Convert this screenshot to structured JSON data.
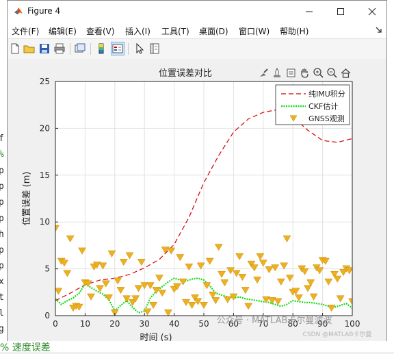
{
  "window": {
    "title": "Figure 4",
    "minimize_label": "—",
    "maximize_label": "☐",
    "close_label": "✕"
  },
  "menu": [
    "文件(F)",
    "编辑(E)",
    "查看(V)",
    "插入(I)",
    "工具(T)",
    "桌面(D)",
    "窗口(W)",
    "帮助(H)"
  ],
  "toolbar": [
    "new-figure",
    "open-file",
    "save",
    "print",
    "link-data",
    "colorbar",
    "legend",
    "edit-plot",
    "property-inspector"
  ],
  "axes_toolbar": [
    "brush",
    "data-tips",
    "export",
    "pan",
    "zoom-in",
    "zoom-out",
    "restore-view"
  ],
  "background": {
    "left_chars": [
      "f",
      "%",
      "p",
      "p",
      "p",
      "p",
      "h",
      "p",
      "p",
      "x",
      "t",
      "l",
      "g"
    ],
    "bottom_text": "% 速度误差"
  },
  "watermark": {
    "line1": "公众号 · MATLAB卡尔曼滤波",
    "line2": "CSDN @MATLAB卡尔曼"
  },
  "chart_data": {
    "type": "line",
    "title": "位置误差对比",
    "xlabel": "时间 (s)",
    "ylabel": "位置误差 (m)",
    "xlim": [
      0,
      100
    ],
    "ylim": [
      0,
      25
    ],
    "xticks": [
      0,
      10,
      20,
      30,
      40,
      50,
      60,
      70,
      80,
      90,
      100
    ],
    "yticks": [
      0,
      5,
      10,
      15,
      20,
      25
    ],
    "grid": true,
    "legend_position": "top-right",
    "colors": {
      "imu": "#d40000",
      "ckf": "#11dd11",
      "gnss": "#edb120"
    },
    "series": [
      {
        "name": "纯IMU积分",
        "style": "dashed",
        "x": [
          0,
          5,
          10,
          15,
          20,
          25,
          30,
          35,
          40,
          45,
          50,
          55,
          60,
          65,
          70,
          75,
          80,
          85,
          90,
          95,
          100
        ],
        "y": [
          1.6,
          2.4,
          3.3,
          3.8,
          4.0,
          4.4,
          5.1,
          6.0,
          7.6,
          10.5,
          14.2,
          17.1,
          19.6,
          21.0,
          21.7,
          22.0,
          21.2,
          19.8,
          18.7,
          18.5,
          18.9
        ]
      },
      {
        "name": "CKF估计",
        "style": "dotted",
        "x": [
          0,
          2,
          4,
          6,
          8,
          10,
          12,
          14,
          16,
          18,
          20,
          22,
          24,
          26,
          28,
          30,
          32,
          34,
          36,
          38,
          40,
          42,
          44,
          46,
          48,
          50,
          52,
          54,
          56,
          58,
          60,
          62,
          64,
          66,
          68,
          70,
          72,
          74,
          76,
          78,
          80,
          82,
          84,
          86,
          88,
          90,
          92,
          94,
          96,
          98,
          100
        ],
        "y": [
          1.8,
          1.2,
          1.6,
          1.9,
          2.4,
          3.4,
          3.0,
          2.6,
          2.3,
          1.7,
          0.5,
          1.1,
          1.6,
          0.9,
          0.3,
          0.5,
          1.9,
          2.6,
          3.1,
          3.6,
          4.0,
          3.8,
          3.7,
          3.9,
          4.0,
          3.8,
          3.2,
          2.4,
          2.2,
          2.0,
          1.9,
          2.0,
          1.8,
          1.7,
          1.6,
          1.5,
          1.4,
          1.2,
          1.0,
          1.2,
          1.6,
          1.5,
          1.4,
          1.4,
          1.3,
          1.2,
          1.0,
          0.9,
          1.1,
          1.3,
          0.8
        ]
      },
      {
        "name": "GNSS观测",
        "style": "triangle-down",
        "x": [
          0,
          1,
          2,
          3,
          4,
          5,
          6,
          7,
          8,
          9,
          10,
          11,
          12,
          13,
          14,
          15,
          16,
          17,
          18,
          19,
          20,
          21,
          22,
          23,
          24,
          25,
          26,
          27,
          28,
          29,
          30,
          31,
          32,
          33,
          34,
          35,
          36,
          37,
          38,
          39,
          40,
          41,
          42,
          43,
          44,
          45,
          46,
          47,
          48,
          49,
          50,
          51,
          52,
          53,
          54,
          55,
          56,
          57,
          58,
          59,
          60,
          61,
          62,
          63,
          64,
          65,
          66,
          67,
          68,
          69,
          70,
          71,
          72,
          73,
          74,
          75,
          76,
          77,
          78,
          79,
          80,
          81,
          82,
          83,
          84,
          85,
          86,
          87,
          88,
          89,
          90,
          91,
          92,
          93,
          94,
          95,
          96,
          97,
          98,
          99,
          100
        ],
        "y": [
          9.3,
          2.6,
          5.8,
          5.6,
          4.5,
          8.2,
          0.8,
          1.0,
          0.9,
          6.9,
          3.5,
          3.4,
          2.0,
          5.2,
          5.4,
          2.9,
          5.3,
          3.4,
          1.9,
          6.6,
          0.3,
          3.7,
          2.7,
          5.7,
          1.8,
          6.4,
          1.4,
          1.8,
          2.9,
          5.7,
          3.2,
          0.4,
          3.2,
          1.1,
          2.7,
          4.0,
          2.4,
          7.0,
          0.3,
          6.9,
          2.8,
          3.1,
          6.2,
          3.6,
          1.4,
          5.2,
          1.1,
          1.9,
          1.5,
          5.3,
          1.1,
          3.2,
          5.8,
          2.2,
          1.6,
          7.3,
          4.4,
          3.5,
          1.7,
          4.8,
          2.0,
          4.5,
          6.3,
          4.1,
          2.7,
          1.0,
          5.5,
          5.1,
          3.8,
          6.3,
          5.6,
          1.7,
          4.9,
          1.6,
          5.1,
          1.5,
          3.6,
          5.3,
          8.2,
          4.0,
          2.5,
          2.6,
          1.9,
          5.0,
          4.7,
          2.9,
          3.5,
          2.0,
          5.1,
          4.8,
          5.9,
          5.8,
          3.6,
          0.8,
          4.4,
          3.9,
          1.8,
          4.6,
          5.0,
          4.8,
          1.5
        ]
      }
    ]
  }
}
